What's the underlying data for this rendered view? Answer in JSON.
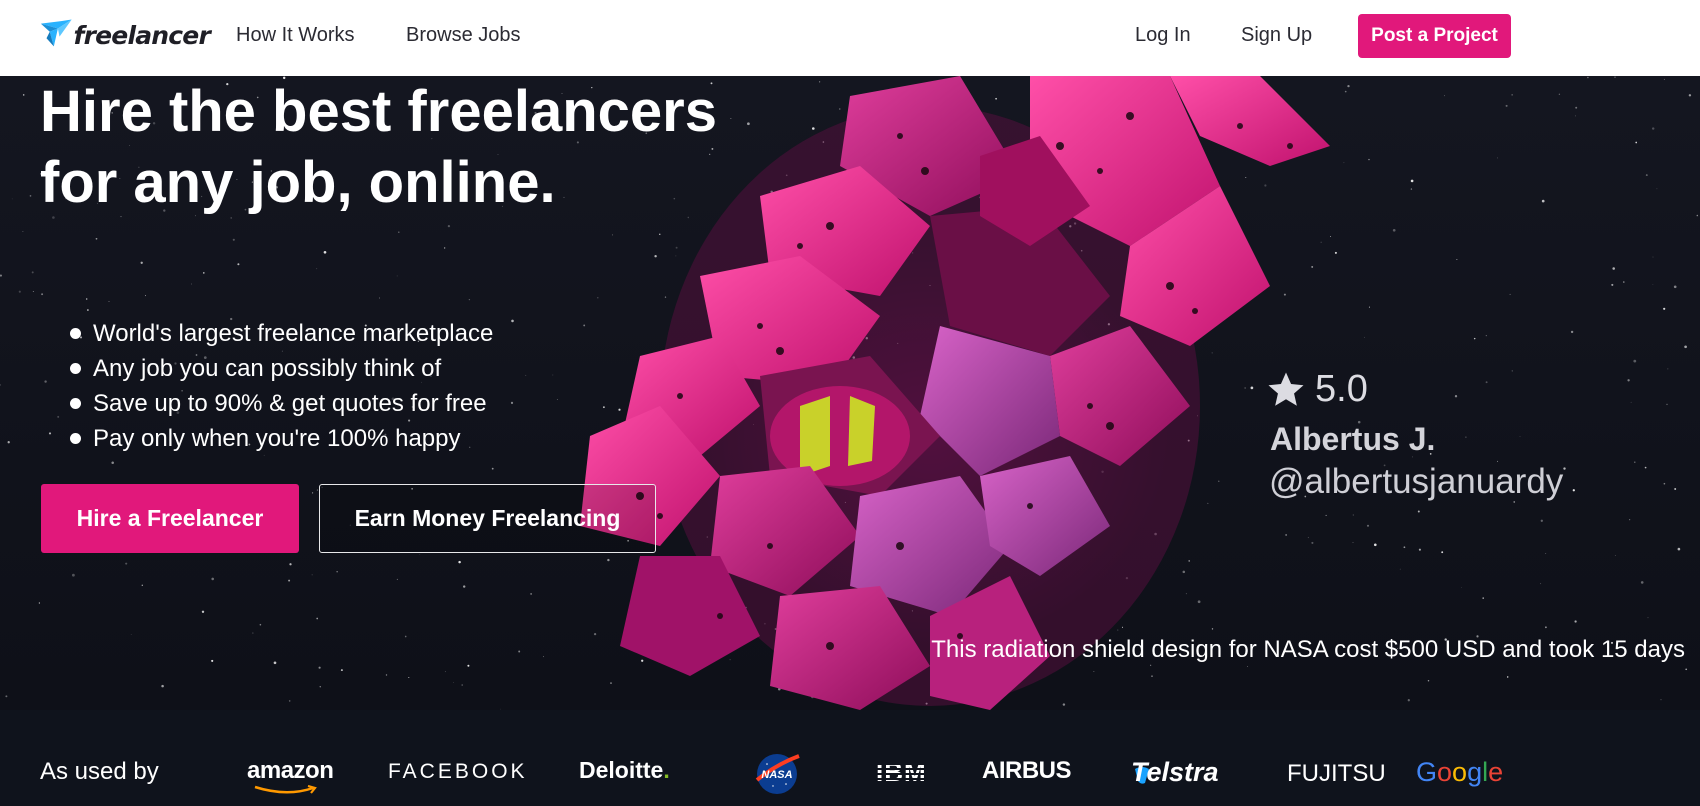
{
  "nav": {
    "logo_text": "freelancer",
    "links": [
      "How It Works",
      "Browse Jobs"
    ],
    "login": "Log In",
    "signup": "Sign Up",
    "post_project": "Post a Project"
  },
  "hero": {
    "title": "Hire the best freelancers for any job, online.",
    "bullets": [
      "World's largest freelance marketplace",
      "Any job you can possibly think of",
      "Save up to 90% & get quotes for free",
      "Pay only when you're 100% happy"
    ],
    "hire_button": "Hire a Freelancer",
    "earn_button": "Earn Money Freelancing",
    "rating": "5.0",
    "freelancer_name": "Albertus J.",
    "freelancer_handle": "@albertusjanuardy",
    "caption": "This radiation shield design for NASA cost $500 USD and took 15 days"
  },
  "used_by": {
    "label": "As used by",
    "brands": {
      "amazon": "amazon",
      "facebook": "FACEBOOK",
      "deloitte": "Deloitte",
      "deloitte_dot": ".",
      "nasa": "NASA",
      "ibm": "IBM",
      "airbus": "AIRBUS",
      "telstra": "Telstra",
      "fujitsu": "FUJITSU",
      "google": [
        "G",
        "o",
        "o",
        "g",
        "l",
        "e"
      ]
    }
  },
  "colors": {
    "accent": "#e1187b",
    "logo_blue": "#29b2fe",
    "hero_bg": "#12141c",
    "deloitte_green": "#86bc25",
    "google": [
      "#4285f4",
      "#ea4335",
      "#fbbc05",
      "#4285f4",
      "#34a853",
      "#ea4335"
    ]
  },
  "icons": {
    "logo": "freelancer-bird-icon",
    "rating": "star-icon"
  }
}
